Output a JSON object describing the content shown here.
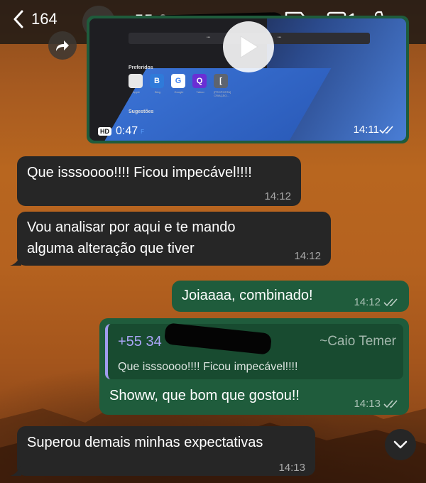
{
  "header": {
    "back_count": "164",
    "contact_name": "+55 3",
    "icons": [
      "chevron-left-icon",
      "person-icon",
      "label-icon",
      "video-call-icon",
      "phone-icon"
    ]
  },
  "video_message": {
    "duration": "0:47",
    "quality": "HD",
    "quality_sub": "F",
    "time": "14:11",
    "preview": {
      "favorites_label": "Preferidos",
      "favorites": [
        {
          "glyph": "",
          "caption": "Apple",
          "color": "#e8e8e8"
        },
        {
          "glyph": "B",
          "caption": "Bing",
          "color": "#2f7ad9"
        },
        {
          "glyph": "G",
          "caption": "Google",
          "color": "#ffffff"
        },
        {
          "glyph": "Q",
          "caption": "Yahoo",
          "color": "#6a2fd4"
        },
        {
          "glyph": "[",
          "caption": "[PROPOSTA] CRIAÇÃO...",
          "color": "#5d6470"
        }
      ],
      "suggestions_label": "Sugestões"
    }
  },
  "messages": [
    {
      "direction": "in",
      "text": "Que isssoooo!!!! Ficou impecável!!!!",
      "time": "14:12"
    },
    {
      "direction": "in",
      "text_lines": [
        "Vou analisar por aqui e te mando",
        "alguma alteração que tiver"
      ],
      "time": "14:12"
    },
    {
      "direction": "out",
      "text": "Joiaaaa, combinado!",
      "time": "14:12",
      "status": "read"
    },
    {
      "direction": "out",
      "reply": {
        "author": "+55 34",
        "author_label": "~Caio Temer",
        "quoted": "Que isssoooo!!!! Ficou impecável!!!!"
      },
      "text": "Showw, que bom que gostou!!",
      "time": "14:13",
      "status": "read"
    },
    {
      "direction": "in",
      "text": "Superou demais minhas expectativas",
      "time": "14:13"
    }
  ],
  "colors": {
    "incoming_bubble": "#262626",
    "outgoing_bubble": "#1f5c3c",
    "quote_accent": "#a09cf0"
  }
}
